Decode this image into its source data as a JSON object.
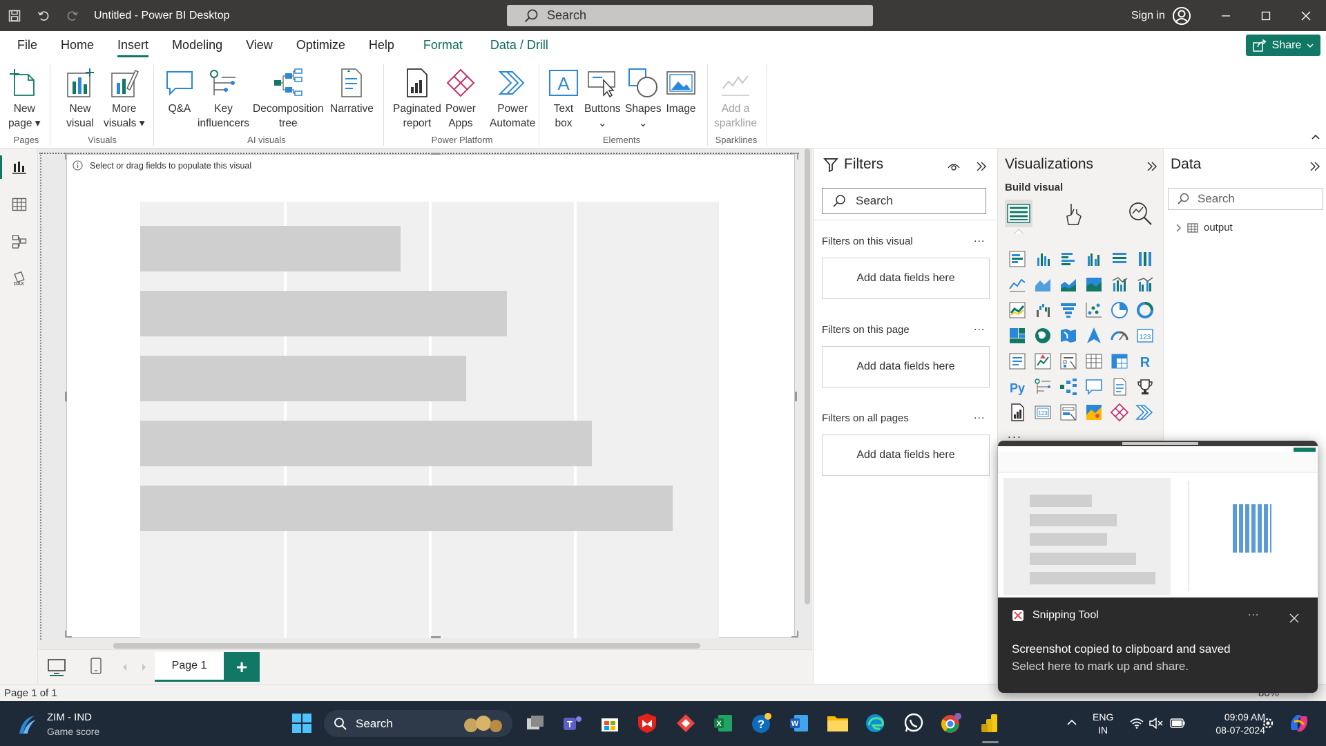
{
  "app": {
    "title": "Untitled - Power BI Desktop",
    "search_placeholder": "Search",
    "sign_in": "Sign in"
  },
  "menu": {
    "tabs": [
      {
        "label": "File"
      },
      {
        "label": "Home"
      },
      {
        "label": "Insert"
      },
      {
        "label": "Modeling"
      },
      {
        "label": "View"
      },
      {
        "label": "Optimize"
      },
      {
        "label": "Help"
      },
      {
        "label": "Format"
      },
      {
        "label": "Data / Drill"
      }
    ],
    "active_tab": "Insert",
    "share_label": "Share"
  },
  "ribbon": {
    "buttons": {
      "new_page": [
        "New",
        "page"
      ],
      "new_visual": [
        "New",
        "visual"
      ],
      "more_visuals": [
        "More",
        "visuals"
      ],
      "qa": [
        "Q&A"
      ],
      "key_influencers": [
        "Key",
        "influencers"
      ],
      "decomposition_tree": [
        "Decomposition",
        "tree"
      ],
      "narrative": [
        "Narrative"
      ],
      "paginated_report": [
        "Paginated",
        "report"
      ],
      "power_apps": [
        "Power",
        "Apps"
      ],
      "power_automate": [
        "Power",
        "Automate"
      ],
      "text_box": [
        "Text",
        "box"
      ],
      "buttons": [
        "Buttons"
      ],
      "shapes": [
        "Shapes"
      ],
      "image": [
        "Image"
      ],
      "add_sparkline": [
        "Add a",
        "sparkline"
      ]
    },
    "groups": {
      "pages": "Pages",
      "visuals": "Visuals",
      "ai_visuals": "AI visuals",
      "power_platform": "Power Platform",
      "elements": "Elements",
      "sparklines": "Sparklines"
    }
  },
  "canvas": {
    "hint": "Select or drag fields to populate this visual",
    "placeholder_bar_fractions": [
      0.45,
      0.634,
      0.563,
      0.78,
      0.92
    ]
  },
  "pages": {
    "tabs": [
      {
        "label": "Page 1"
      }
    ],
    "add_label": "+"
  },
  "status": {
    "page_info": "Page 1 of 1",
    "zoom": "80%"
  },
  "filters": {
    "title": "Filters",
    "search_placeholder": "Search",
    "sections": [
      {
        "label": "Filters on this visual",
        "box": "Add data fields here"
      },
      {
        "label": "Filters on this page",
        "box": "Add data fields here"
      },
      {
        "label": "Filters on all pages",
        "box": "Add data fields here"
      }
    ],
    "more": "..."
  },
  "visualizations": {
    "title": "Visualizations",
    "build_visual": "Build visual",
    "more": "..."
  },
  "data_pane": {
    "title": "Data",
    "search_placeholder": "Search",
    "tables": [
      {
        "name": "output"
      }
    ]
  },
  "toast": {
    "app_name": "Snipping Tool",
    "message": "Screenshot copied to clipboard and saved",
    "sub": "Select here to mark up and share.",
    "more": "..."
  },
  "taskbar": {
    "widget_title": "ZIM - IND",
    "widget_sub": "Game score",
    "search_label": "Search",
    "lang_top": "ENG",
    "lang_bottom": "IN",
    "time": "09:09 AM",
    "date": "08-07-2024"
  },
  "colors": {
    "accent": "#117865",
    "titlebar": "#3b3a39",
    "taskbar": "#1f2a38",
    "placeholder_bar": "#cfcfcf"
  }
}
